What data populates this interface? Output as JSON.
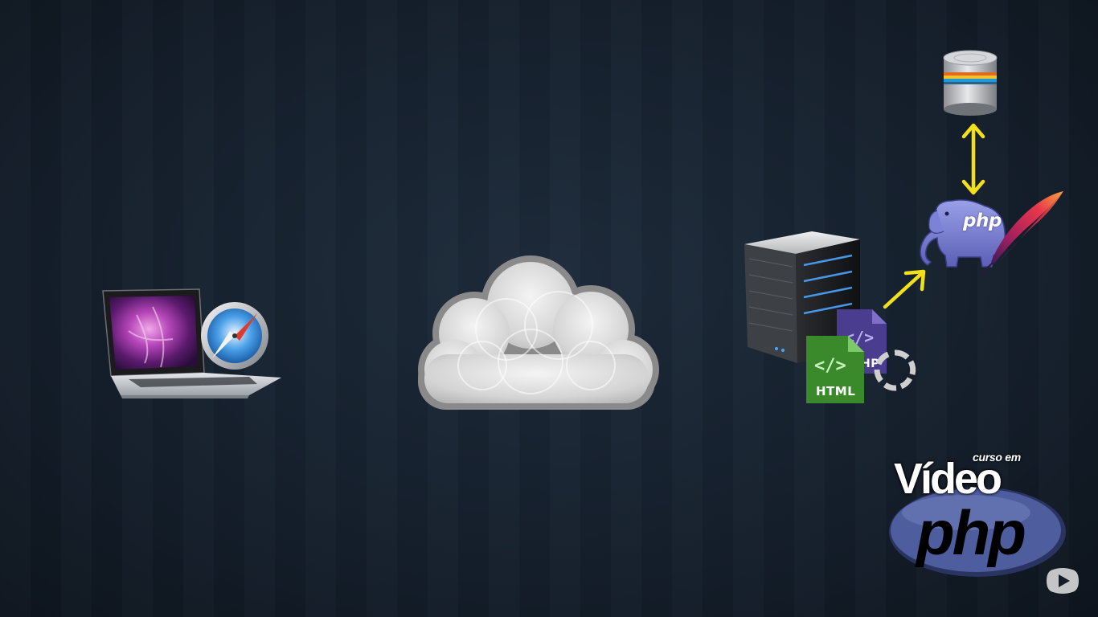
{
  "scene": {
    "background_color": "#141d29",
    "accent_arrow_color": "#f2e019"
  },
  "client": {
    "laptop_icon": "laptop-icon",
    "browser_icon": "safari-compass-icon"
  },
  "network": {
    "cloud_icon": "cloud-icon"
  },
  "server_side": {
    "server_icon": "server-icon",
    "html_file_label": "HTML",
    "php_file_label": "HP",
    "spinner_icon": "loading-spinner-icon",
    "php_label": "php",
    "php_mascot_icon": "php-elephant-icon",
    "apache_icon": "apache-feather-icon",
    "database_icon": "database-icon",
    "html_color": "#3a8a2c",
    "php_color": "#4a3d8f"
  },
  "brand": {
    "small_text": "curso em",
    "video_text": "Vídeo",
    "php_text": "php",
    "oval_color": "#4d5d9e"
  },
  "player": {
    "youtube_icon": "youtube-play-icon"
  }
}
